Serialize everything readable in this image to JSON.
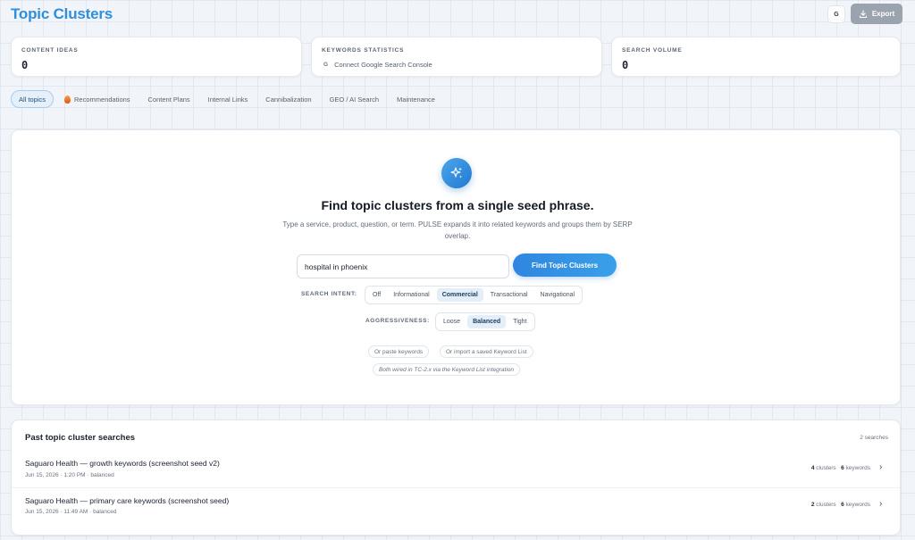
{
  "header": {
    "title": "Topic Clusters",
    "account_button": "G",
    "export_label": "Export"
  },
  "stats": [
    {
      "label": "CONTENT IDEAS",
      "value": "0"
    },
    {
      "label": "KEYWORDS STATISTICS",
      "connect_icon": "G",
      "connect_text": "Connect Google Search Console"
    },
    {
      "label": "SEARCH VOLUME",
      "value": "0"
    }
  ],
  "tabs": [
    {
      "label": "All topics",
      "active": true
    },
    {
      "label": "Recommendations",
      "icon": "flame-icon"
    },
    {
      "label": "Content Plans"
    },
    {
      "label": "Internal Links"
    },
    {
      "label": "Cannibalization"
    },
    {
      "label": "GEO / AI Search"
    },
    {
      "label": "Maintenance"
    }
  ],
  "finder": {
    "icon": "sparkles-icon",
    "headline": "Find topic clusters from a single seed phrase.",
    "subtitle": "Type a service, product, question, or term. PULSE expands it into related keywords and groups them by SERP overlap.",
    "seed_value": "hospital in phoenix",
    "button_label": "Find Topic Clusters",
    "intent_label": "SEARCH INTENT:",
    "intent_options": [
      "Off",
      "Informational",
      "Commercial",
      "Transactional",
      "Navigational"
    ],
    "intent_selected": "Commercial",
    "aggr_label": "AGGRESSIVENESS:",
    "aggr_options": [
      "Loose",
      "Balanced",
      "Tight"
    ],
    "aggr_selected": "Balanced",
    "paste_label": "Or paste keywords",
    "import_label": "Or import a saved Keyword List",
    "note": "Both wired in TC-2.x via the Keyword List integration"
  },
  "past": {
    "title": "Past topic cluster searches",
    "count": "2 searches",
    "rows": [
      {
        "name": "Saguaro Health — growth keywords (screenshot seed v2)",
        "meta": "Jun 15, 2026 · 1:20 PM · balanced",
        "clusters": "4",
        "clusters_label": "clusters",
        "keywords": "6",
        "keywords_label": "keywords"
      },
      {
        "name": "Saguaro Health — primary care keywords (screenshot seed)",
        "meta": "Jun 15, 2026 · 11:49 AM · balanced",
        "clusters": "2",
        "clusters_label": "clusters",
        "keywords": "6",
        "keywords_label": "keywords"
      }
    ]
  }
}
